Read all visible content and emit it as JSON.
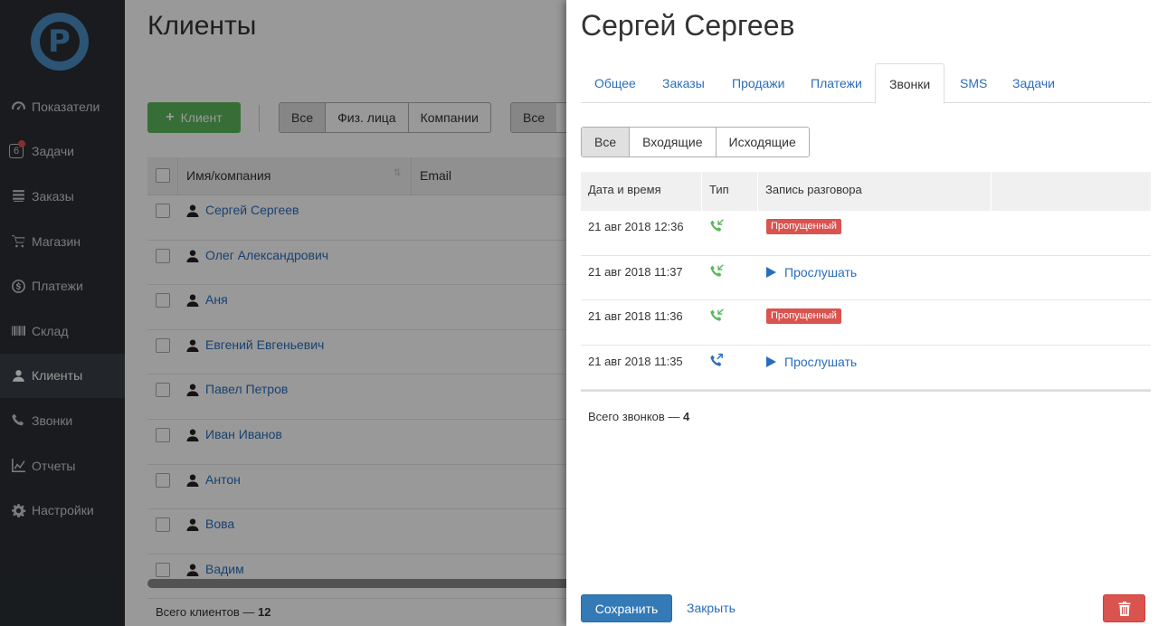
{
  "sidebar": {
    "items": [
      {
        "label": "Показатели",
        "icon": "gauge-icon"
      },
      {
        "label": "Задачи",
        "icon": "calendar-icon",
        "badge": "6"
      },
      {
        "label": "Заказы",
        "icon": "orders-icon"
      },
      {
        "label": "Магазин",
        "icon": "cart-icon"
      },
      {
        "label": "Платежи",
        "icon": "dollar-icon"
      },
      {
        "label": "Склад",
        "icon": "barcode-icon"
      },
      {
        "label": "Клиенты",
        "icon": "users-icon",
        "active": true
      },
      {
        "label": "Звонки",
        "icon": "phone-icon"
      },
      {
        "label": "Отчеты",
        "icon": "chart-icon"
      },
      {
        "label": "Настройки",
        "icon": "gear-icon"
      }
    ]
  },
  "page": {
    "title": "Клиенты",
    "add_button": "Клиент",
    "type_filter": [
      "Все",
      "Физ. лица",
      "Компании"
    ],
    "second_filter": [
      "Все"
    ],
    "columns": [
      "Имя/компания",
      "Email"
    ],
    "clients": [
      "Сергей Сергеев",
      "Олег Александрович",
      "Аня",
      "Евгений Евгеньевич",
      "Павел Петров",
      "Иван Иванов",
      "Антон",
      "Вова",
      "Вадим"
    ],
    "total_label": "Всего клиентов —",
    "total_value": "12"
  },
  "drawer": {
    "title": "Сергей Сергеев",
    "tabs": [
      "Общее",
      "Заказы",
      "Продажи",
      "Платежи",
      "Звонки",
      "SMS",
      "Задачи"
    ],
    "active_tab": "Звонки",
    "filter": [
      "Все",
      "Входящие",
      "Исходящие"
    ],
    "columns": [
      "Дата и время",
      "Тип",
      "Запись разговора"
    ],
    "calls": [
      {
        "datetime": "21 авг 2018 12:36",
        "type": "incoming",
        "status": "Пропущенный"
      },
      {
        "datetime": "21 авг 2018 11:37",
        "type": "incoming",
        "play": "Прослушать"
      },
      {
        "datetime": "21 авг 2018 11:36",
        "type": "incoming",
        "status": "Пропущенный"
      },
      {
        "datetime": "21 авг 2018 11:35",
        "type": "outgoing",
        "play": "Прослушать"
      }
    ],
    "total_label": "Всего звонков —",
    "total_value": "4",
    "save": "Сохранить",
    "close": "Закрыть"
  },
  "colors": {
    "sidebar_bg": "#2a2e33",
    "accent": "#2a6ebb",
    "primary": "#337ab7",
    "success": "#5cb85c",
    "danger": "#d9534f",
    "incoming_call": "#5cb85c",
    "outgoing_call": "#2a6ebb"
  }
}
